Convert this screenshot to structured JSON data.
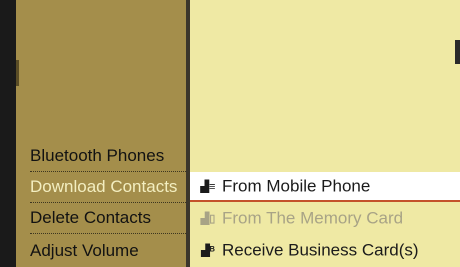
{
  "menu": {
    "items": [
      {
        "label": "Bluetooth Phones"
      },
      {
        "label": "Download Contacts"
      },
      {
        "label": "Delete Contacts"
      },
      {
        "label": "Adjust Volume"
      }
    ]
  },
  "submenu": {
    "items": [
      {
        "label": "From Mobile Phone",
        "icon": "phone-contacts-icon"
      },
      {
        "label": "From The Memory Card",
        "icon": "memory-card-contacts-icon"
      },
      {
        "label": "Receive Business Card(s)",
        "icon": "bluetooth-contacts-icon"
      }
    ]
  },
  "colors": {
    "left_panel": "#a48e4b",
    "right_panel": "#efe9a4",
    "highlight": "#ffffff",
    "highlight_underline": "#c4522a",
    "selected_text": "#f3eec0",
    "disabled_text": "#a8a386"
  }
}
